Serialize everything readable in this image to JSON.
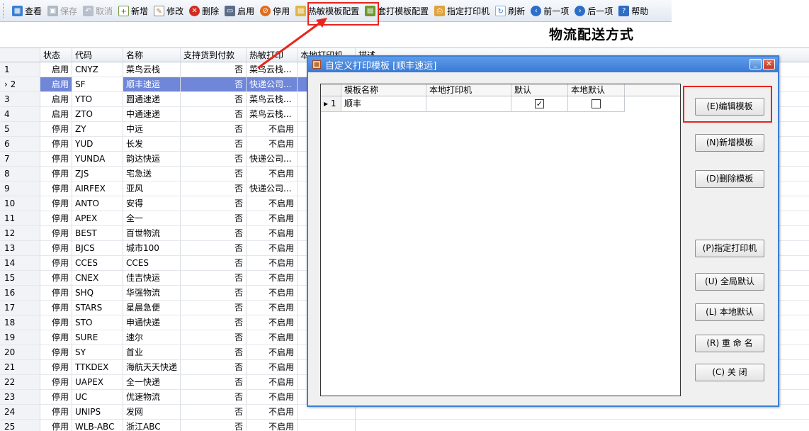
{
  "toolbar": {
    "items": [
      {
        "label": "查看",
        "icon": "calendar-grid-icon",
        "enabled": true
      },
      {
        "label": "保存",
        "icon": "floppy-disk-icon",
        "enabled": false
      },
      {
        "label": "取消",
        "icon": "undo-arrow-icon",
        "enabled": false
      },
      {
        "label": "新增",
        "icon": "new-document-icon",
        "enabled": true
      },
      {
        "label": "修改",
        "icon": "edit-pencil-icon",
        "enabled": true
      },
      {
        "label": "删除",
        "icon": "delete-x-icon",
        "enabled": true
      },
      {
        "label": "启用",
        "icon": "monitor-icon",
        "enabled": true
      },
      {
        "label": "停用",
        "icon": "stop-icon",
        "enabled": true
      },
      {
        "label": "热敏模板配置",
        "icon": "thermal-template-icon",
        "enabled": true
      },
      {
        "label": "套打模板配置",
        "icon": "template-icon",
        "enabled": true
      },
      {
        "label": "指定打印机",
        "icon": "printer-icon",
        "enabled": true
      },
      {
        "label": "刷新",
        "icon": "refresh-icon",
        "enabled": true
      },
      {
        "label": "前一项",
        "icon": "previous-icon",
        "enabled": true
      },
      {
        "label": "后一项",
        "icon": "next-icon",
        "enabled": true
      },
      {
        "label": "帮助",
        "icon": "help-icon",
        "enabled": true
      }
    ]
  },
  "page_title": "物流配送方式",
  "grid": {
    "headers": [
      "",
      "状态",
      "代码",
      "名称",
      "支持货到付款",
      "热敏打印",
      "本地打印机",
      "描述"
    ],
    "selected_row": 1,
    "rows": [
      [
        "1",
        "启用",
        "CNYZ",
        "菜鸟云栈",
        "否",
        "菜鸟云栈...",
        "",
        ""
      ],
      [
        "2",
        "启用",
        "SF",
        "顺丰速运",
        "否",
        "快递公司...",
        "",
        ""
      ],
      [
        "3",
        "启用",
        "YTO",
        "圆通速递",
        "否",
        "菜鸟云栈...",
        "",
        ""
      ],
      [
        "4",
        "启用",
        "ZTO",
        "中通速递",
        "否",
        "菜鸟云栈...",
        "",
        ""
      ],
      [
        "5",
        "停用",
        "ZY",
        "中远",
        "否",
        "不启用",
        "",
        ""
      ],
      [
        "6",
        "停用",
        "YUD",
        "长发",
        "否",
        "不启用",
        "",
        ""
      ],
      [
        "7",
        "停用",
        "YUNDA",
        "韵达快运",
        "否",
        "快递公司...",
        "",
        ""
      ],
      [
        "8",
        "停用",
        "ZJS",
        "宅急送",
        "否",
        "不启用",
        "",
        ""
      ],
      [
        "9",
        "停用",
        "AIRFEX",
        "亚风",
        "否",
        "快递公司...",
        "",
        ""
      ],
      [
        "10",
        "停用",
        "ANTO",
        "安得",
        "否",
        "不启用",
        "",
        ""
      ],
      [
        "11",
        "停用",
        "APEX",
        "全一",
        "否",
        "不启用",
        "",
        ""
      ],
      [
        "12",
        "停用",
        "BEST",
        "百世物流",
        "否",
        "不启用",
        "",
        ""
      ],
      [
        "13",
        "停用",
        "BJCS",
        "城市100",
        "否",
        "不启用",
        "",
        ""
      ],
      [
        "14",
        "停用",
        "CCES",
        "CCES",
        "否",
        "不启用",
        "",
        ""
      ],
      [
        "15",
        "停用",
        "CNEX",
        "佳吉快运",
        "否",
        "不启用",
        "",
        ""
      ],
      [
        "16",
        "停用",
        "SHQ",
        "华强物流",
        "否",
        "不启用",
        "",
        ""
      ],
      [
        "17",
        "停用",
        "STARS",
        "星晨急便",
        "否",
        "不启用",
        "",
        ""
      ],
      [
        "18",
        "停用",
        "STO",
        "申通快递",
        "否",
        "不启用",
        "",
        ""
      ],
      [
        "19",
        "停用",
        "SURE",
        "速尔",
        "否",
        "不启用",
        "",
        ""
      ],
      [
        "20",
        "停用",
        "SY",
        "首业",
        "否",
        "不启用",
        "",
        ""
      ],
      [
        "21",
        "停用",
        "TTKDEX",
        "海航天天快递",
        "否",
        "不启用",
        "",
        ""
      ],
      [
        "22",
        "停用",
        "UAPEX",
        "全一快递",
        "否",
        "不启用",
        "",
        ""
      ],
      [
        "23",
        "停用",
        "UC",
        "优速物流",
        "否",
        "不启用",
        "",
        ""
      ],
      [
        "24",
        "停用",
        "UNIPS",
        "发网",
        "否",
        "不启用",
        "",
        ""
      ],
      [
        "25",
        "停用",
        "WLB-ABC",
        "浙江ABC",
        "否",
        "不启用",
        "",
        ""
      ]
    ]
  },
  "dialog": {
    "title": "自定义打印模板 [顺丰速运]",
    "table": {
      "headers": [
        "",
        "模板名称",
        "本地打印机",
        "默认",
        "本地默认"
      ],
      "rows": [
        {
          "index": "1",
          "name": "顺丰",
          "printer": "",
          "default": true,
          "local_default": false
        }
      ]
    },
    "buttons": [
      "(E)编辑模板",
      "(N)新增模板",
      "(D)删除模板",
      "(P)指定打印机",
      "(U) 全局默认",
      "(L) 本地默认",
      "(R) 重 命 名",
      "(C) 关 闭"
    ]
  },
  "colors": {
    "highlight": "#e8251c",
    "selection": "#6f86d9",
    "title_bar": "#3a7ad4"
  }
}
